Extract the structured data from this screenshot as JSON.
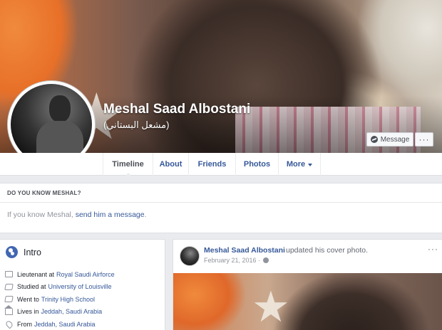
{
  "profile": {
    "name": "Meshal Saad Albostani",
    "alt_name": "(مشعل البستاني)"
  },
  "cover_actions": {
    "message_label": "Message",
    "more_label": "···"
  },
  "nav": {
    "tabs": [
      {
        "label": "Timeline",
        "active": true
      },
      {
        "label": "About"
      },
      {
        "label": "Friends"
      },
      {
        "label": "Photos"
      },
      {
        "label": "More"
      }
    ]
  },
  "do_you_know": {
    "title": "DO YOU KNOW MESHAL?",
    "text_before": "If you know Meshal, ",
    "link": "send him a message",
    "text_after": "."
  },
  "intro": {
    "title": "Intro",
    "items": [
      {
        "icon": "briefcase-icon",
        "prefix": "Lieutenant at",
        "link": "Royal Saudi Airforce"
      },
      {
        "icon": "graduation-cap-icon",
        "prefix": "Studied at",
        "link": "University of Louisville"
      },
      {
        "icon": "graduation-cap-icon",
        "prefix": "Went to",
        "link": "Trinity High School"
      },
      {
        "icon": "house-icon",
        "prefix": "Lives in",
        "link": "Jeddah, Saudi Arabia"
      },
      {
        "icon": "location-pin-icon",
        "prefix": "From",
        "link": "Jeddah, Saudi Arabia"
      }
    ]
  },
  "post": {
    "author": "Meshal Saad Albostani",
    "action": "updated his cover photo.",
    "date": "February 21, 2016 ·",
    "options_label": "···"
  },
  "colors": {
    "link": "#365899",
    "page_bg": "#e9ebee",
    "accent": "#4267b2"
  }
}
